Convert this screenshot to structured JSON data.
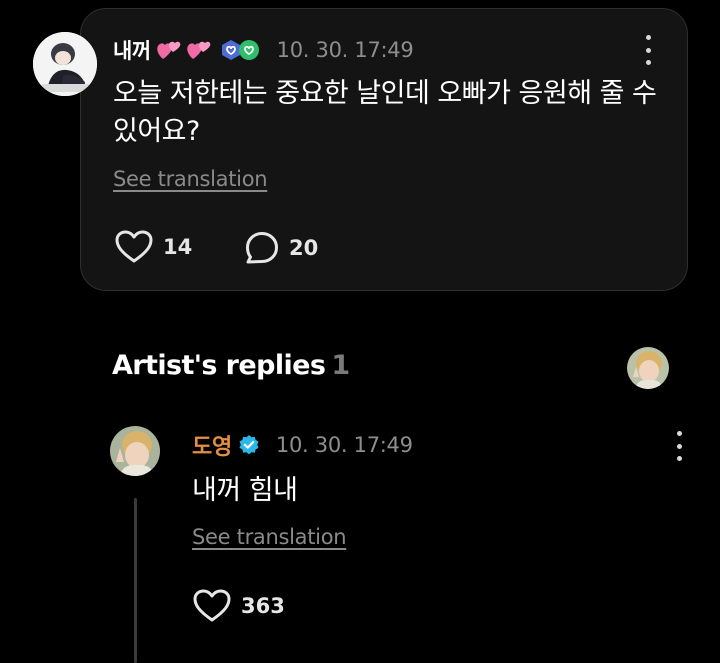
{
  "post": {
    "author": "내꺼",
    "timestamp": "10. 30. 17:49",
    "body": "오늘 저한테는 중요한 날인데 오빠가 응원해 줄 수 있어요?",
    "see_translation": "See translation",
    "likes": "14",
    "comments": "20"
  },
  "replies_section": {
    "title": "Artist's replies",
    "count": "1"
  },
  "reply": {
    "author": "도영",
    "timestamp": "10. 30. 17:49",
    "body": "내꺼 힘내",
    "see_translation": "See translation",
    "likes": "363"
  },
  "colors": {
    "background": "#000000",
    "card": "#141414",
    "artist_name": "#e38f3f",
    "muted": "#8e8e8e",
    "hearts_pink": "#f06aa6",
    "verified_blue": "#2bb8e8",
    "badge_green": "#2fbf6a",
    "badge_blue": "#4e6bd6"
  },
  "icons": [
    "two-hearts-icon",
    "membership-badge-icon",
    "verified-check-icon",
    "like-heart-icon",
    "comment-bubble-icon",
    "more-options-icon"
  ]
}
